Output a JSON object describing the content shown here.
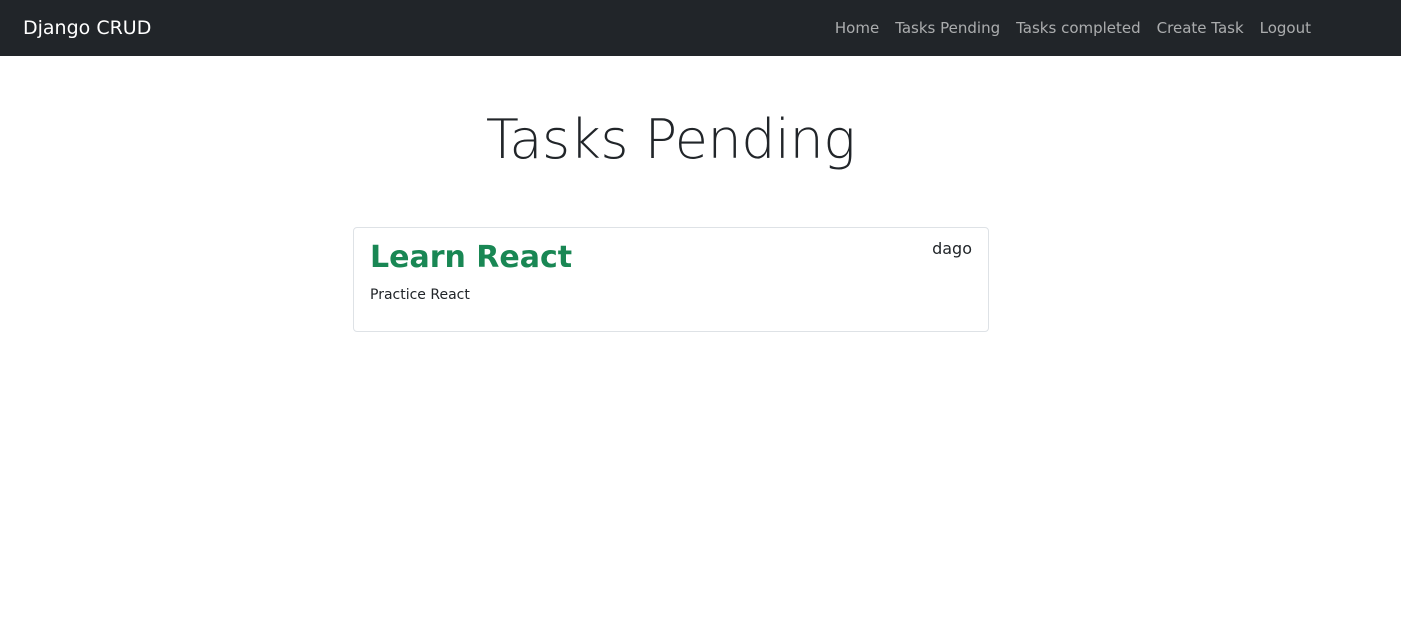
{
  "navbar": {
    "brand": "Django CRUD",
    "links": [
      "Home",
      "Tasks Pending",
      "Tasks completed",
      "Create Task",
      "Logout"
    ]
  },
  "main": {
    "title": "Tasks Pending",
    "tasks": [
      {
        "title": "Learn React",
        "user": "dago",
        "description": "Practice React"
      }
    ]
  },
  "colors": {
    "navbar_bg": "#212529",
    "task_title": "#198754"
  }
}
